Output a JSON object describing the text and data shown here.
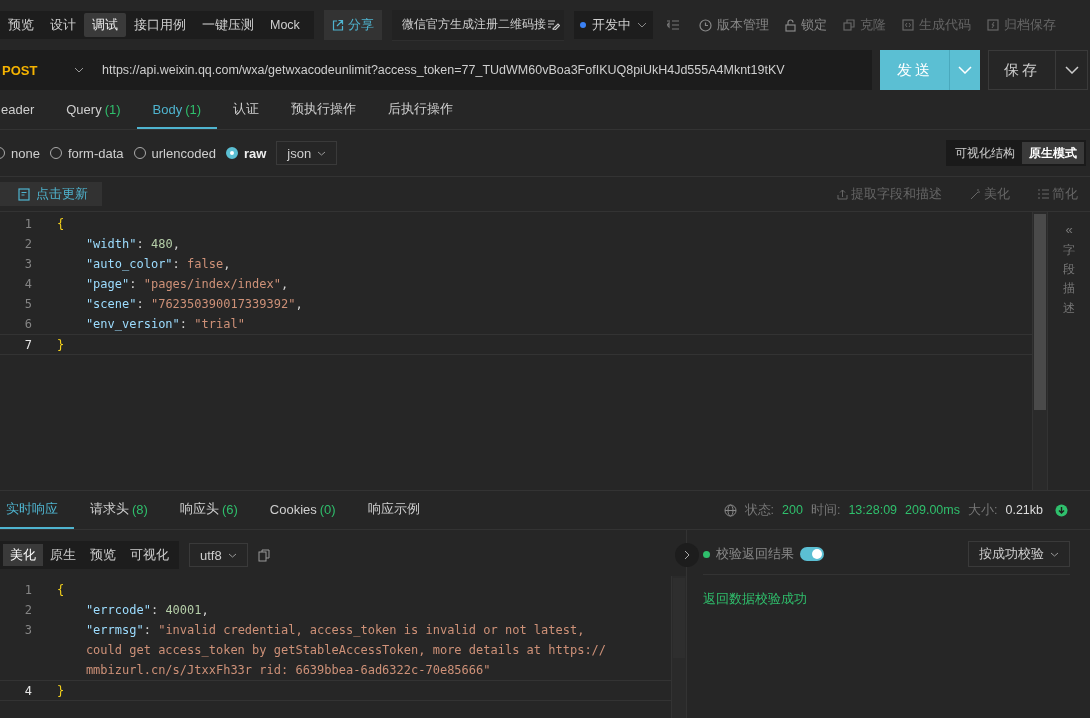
{
  "top_tabs": [
    {
      "label": "预览",
      "selected": false
    },
    {
      "label": "设计",
      "selected": false
    },
    {
      "label": "调试",
      "selected": true
    },
    {
      "label": "接口用例",
      "selected": false
    },
    {
      "label": "一键压测",
      "selected": false
    },
    {
      "label": "Mock",
      "selected": false
    }
  ],
  "share": "分享",
  "doc_title": "微信官方生成注册二维码接",
  "environment": "开发中",
  "actions": [
    {
      "label": "版本管理"
    },
    {
      "label": "锁定"
    },
    {
      "label": "克隆"
    },
    {
      "label": "生成代码"
    },
    {
      "label": "归档保存"
    }
  ],
  "request": {
    "method": "POST",
    "url": "https://api.weixin.qq.com/wxa/getwxacodeunlimit?access_token=77_TUdWM60vBoa3FofIKUQ8piUkH4Jd555A4Mknt19tKV",
    "send": "发送",
    "save": "保存"
  },
  "request_tabs": [
    {
      "label": "eader",
      "selected": false
    },
    {
      "label": "Query",
      "count": "(1)",
      "selected": false
    },
    {
      "label": "Body",
      "count": "(1)",
      "selected": true
    },
    {
      "label": "认证",
      "selected": false
    },
    {
      "label": "预执行操作",
      "selected": false
    },
    {
      "label": "后执行操作",
      "selected": false
    }
  ],
  "body_types": [
    {
      "label": "none",
      "selected": false
    },
    {
      "label": "form-data",
      "selected": false
    },
    {
      "label": "urlencoded",
      "selected": false
    },
    {
      "label": "raw",
      "selected": true
    }
  ],
  "format": "json",
  "modes": [
    {
      "label": "可视化结构",
      "selected": false
    },
    {
      "label": "原生模式",
      "selected": true
    }
  ],
  "refresh": "点击更新",
  "tools": [
    {
      "label": "提取字段和描述"
    },
    {
      "label": "美化"
    },
    {
      "label": "简化"
    }
  ],
  "side_panel": {
    "arrow": "«",
    "label": "字段描述"
  },
  "request_body": [
    {
      "num": "1",
      "current": false,
      "tokens": [
        {
          "kind": "brace",
          "text": "{"
        }
      ]
    },
    {
      "num": "2",
      "current": false,
      "tokens": [
        {
          "kind": "key",
          "text": "    \"width\""
        },
        {
          "kind": "punct",
          "text": ": "
        },
        {
          "kind": "num",
          "text": "480"
        },
        {
          "kind": "punct",
          "text": ","
        }
      ]
    },
    {
      "num": "3",
      "current": false,
      "tokens": [
        {
          "kind": "key",
          "text": "    \"auto_color\""
        },
        {
          "kind": "punct",
          "text": ": "
        },
        {
          "kind": "str",
          "text": "false"
        },
        {
          "kind": "punct",
          "text": ","
        }
      ]
    },
    {
      "num": "4",
      "current": false,
      "tokens": [
        {
          "kind": "key",
          "text": "    \"page\""
        },
        {
          "kind": "punct",
          "text": ": "
        },
        {
          "kind": "str",
          "text": "\"pages/index/index\""
        },
        {
          "kind": "punct",
          "text": ","
        }
      ]
    },
    {
      "num": "5",
      "current": false,
      "tokens": [
        {
          "kind": "key",
          "text": "    \"scene\""
        },
        {
          "kind": "punct",
          "text": ": "
        },
        {
          "kind": "str",
          "text": "\"762350390017339392\""
        },
        {
          "kind": "punct",
          "text": ","
        }
      ]
    },
    {
      "num": "6",
      "current": false,
      "tokens": [
        {
          "kind": "key",
          "text": "    \"env_version\""
        },
        {
          "kind": "punct",
          "text": ": "
        },
        {
          "kind": "str",
          "text": "\"trial\""
        }
      ]
    },
    {
      "num": "7",
      "current": true,
      "tokens": [
        {
          "kind": "brace",
          "text": "}"
        }
      ]
    }
  ],
  "response_tabs": [
    {
      "label": "实时响应",
      "selected": true
    },
    {
      "label": "请求头",
      "count": "(8)",
      "selected": false
    },
    {
      "label": "响应头",
      "count": "(6)",
      "selected": false
    },
    {
      "label": "Cookies",
      "count": "(0)",
      "selected": false
    },
    {
      "label": "响应示例",
      "selected": false
    }
  ],
  "status": [
    {
      "label": "状态:",
      "value": "200",
      "kind": "good"
    },
    {
      "label": "时间:",
      "value": "13:28:09",
      "kind": "good"
    },
    {
      "value": "209.00ms",
      "kind": "good"
    },
    {
      "label": "大小:",
      "value": "0.21kb",
      "kind": "plain"
    }
  ],
  "view_modes": [
    {
      "label": "美化",
      "selected": true
    },
    {
      "label": "原生",
      "selected": false
    },
    {
      "label": "预览",
      "selected": false
    },
    {
      "label": "可视化",
      "selected": false
    }
  ],
  "encoding": "utf8",
  "response_body": [
    {
      "num": "1",
      "current": false,
      "tokens": [
        {
          "kind": "brace",
          "text": "{"
        }
      ]
    },
    {
      "num": "2",
      "current": false,
      "tokens": [
        {
          "kind": "key",
          "text": "    \"errcode\""
        },
        {
          "kind": "punct",
          "text": ": "
        },
        {
          "kind": "num",
          "text": "40001"
        },
        {
          "kind": "punct",
          "text": ","
        }
      ]
    },
    {
      "num": "3",
      "current": false,
      "tokens": [
        {
          "kind": "key",
          "text": "    \"errmsg\""
        },
        {
          "kind": "punct",
          "text": ": "
        },
        {
          "kind": "str",
          "text": "\"invalid credential, access_token is invalid or not latest,"
        }
      ]
    },
    {
      "current": false,
      "tokens": [
        {
          "kind": "str",
          "text": "    could get access_token by getStableAccessToken, more details at https://"
        }
      ]
    },
    {
      "current": false,
      "tokens": [
        {
          "kind": "str",
          "text": "    mmbizurl.cn/s/JtxxFh33r rid: 6639bbea-6ad6322c-70e85666\""
        }
      ]
    },
    {
      "num": "4",
      "current": true,
      "tokens": [
        {
          "kind": "brace",
          "text": "}"
        }
      ]
    }
  ],
  "validation": {
    "label": "校验返回结果",
    "on": true,
    "rule": "按成功校验",
    "result": "返回数据校验成功"
  }
}
